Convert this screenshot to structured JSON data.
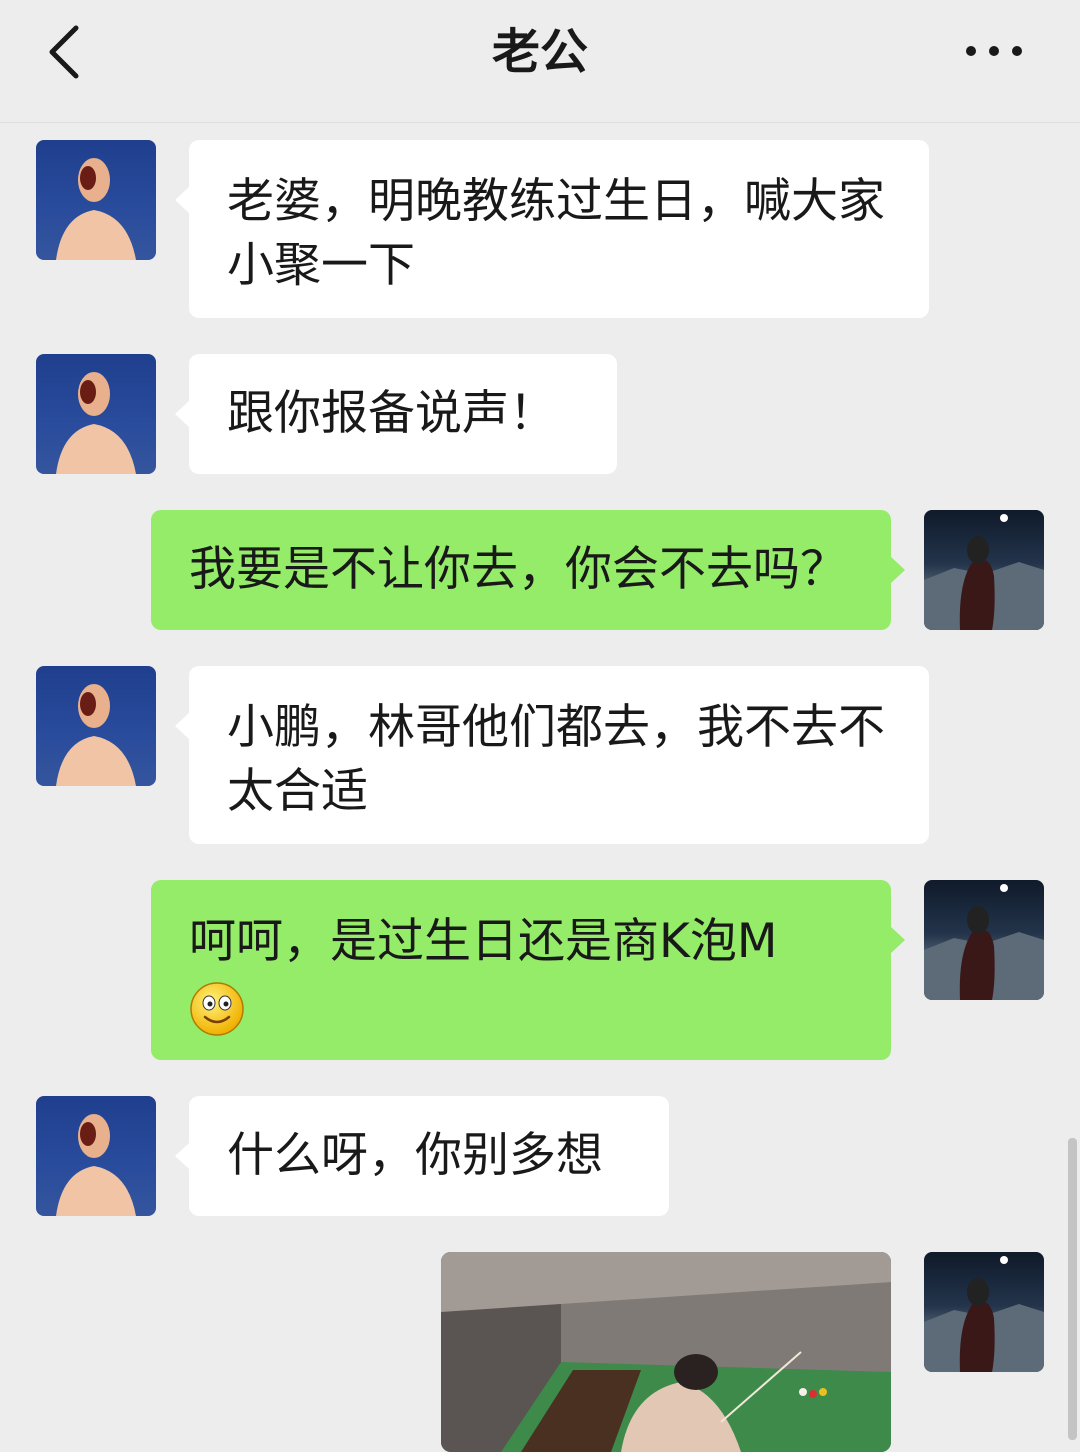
{
  "header": {
    "title": "老公"
  },
  "messages": [
    {
      "side": "in",
      "text": "老婆，明晚教练过生日，喊大家小聚一下"
    },
    {
      "side": "in",
      "text": "跟你报备说声！"
    },
    {
      "side": "out",
      "text": "我要是不让你去，你会不去吗？"
    },
    {
      "side": "in",
      "text": "小鹏，林哥他们都去，我不去不太合适"
    },
    {
      "side": "out",
      "text": "呵呵，是过生日还是商K泡M"
    },
    {
      "side": "in",
      "text": "什么呀，你别多想"
    },
    {
      "side": "out",
      "type": "image"
    }
  ],
  "colors": {
    "background": "#ededed",
    "incoming_bubble": "#ffffff",
    "outgoing_bubble": "#95ec69"
  },
  "icons": [
    "back-chevron-icon",
    "more-dots-icon",
    "smile-emoji-icon"
  ]
}
